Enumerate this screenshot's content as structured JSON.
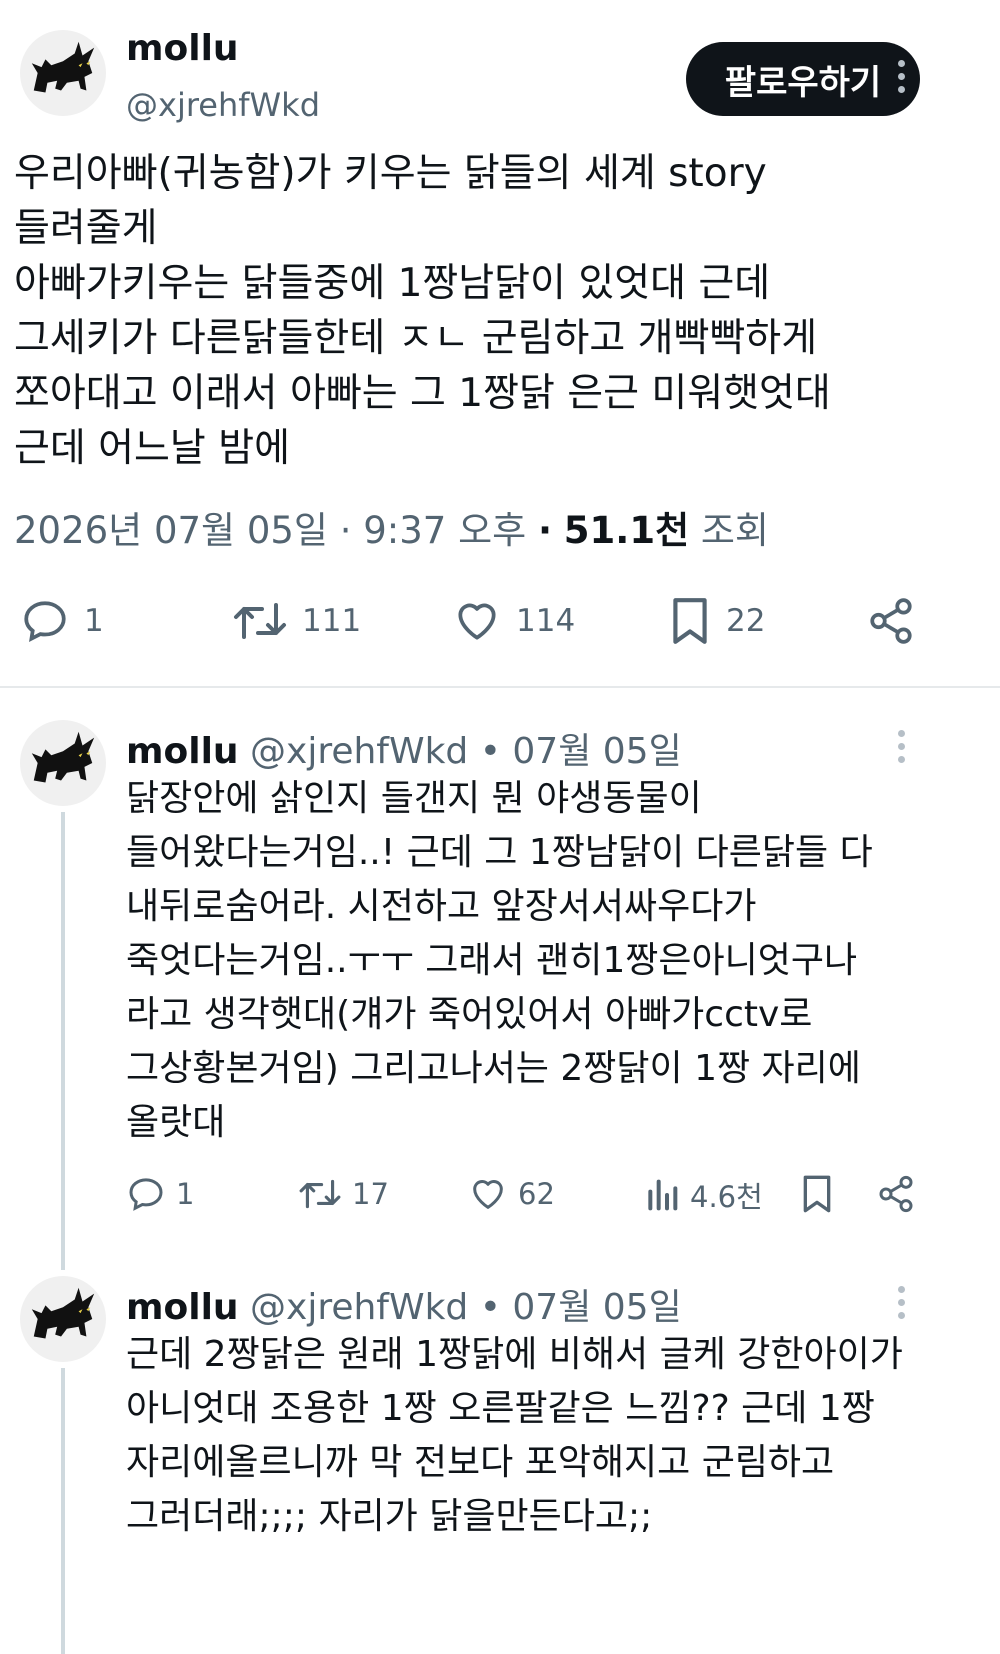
{
  "main_post": {
    "display_name": "mollu",
    "handle": "@xjrehfWkd",
    "follow_label": "팔로우하기",
    "text": "우리아빠(귀농함)가 키우는 닭들의 세계 story\n들려줄게\n아빠가키우는 닭들중에 1짱남닭이 있엇대 근데\n그세키가 다른닭들한테 ㅈㄴ 군림하고 개빡빡하게\n쪼아대고 이래서 아빠는 그 1짱닭 은근 미워햇엇대\n근데 어느날 밤에",
    "date": "2026년 07월 05일 · 9:37 오후",
    "dot": "·",
    "views_count": "51.1천",
    "views_label": "조회",
    "actions": {
      "replies": "1",
      "retweets": "111",
      "likes": "114",
      "bookmarks": "22"
    }
  },
  "replies": [
    {
      "display_name": "mollu",
      "handle_date": "@xjrehfWkd • 07월 05일",
      "text": "닭장안에 삵인지 들갠지 뭔 야생동물이\n들어왔다는거임..! 근데 그 1짱남닭이 다른닭들 다\n내뒤로숨어라. 시전하고 앞장서서싸우다가\n죽엇다는거임..ㅜㅜ 그래서 괜히1짱은아니엇구나\n라고 생각햇대(걔가 죽어있어서 아빠가cctv로\n그상황본거임) 그리고나서는 2짱닭이 1짱 자리에\n올랏대",
      "actions": {
        "replies": "1",
        "retweets": "17",
        "likes": "62",
        "views": "4.6천"
      }
    },
    {
      "display_name": "mollu",
      "handle_date": "@xjrehfWkd • 07월 05일",
      "text": "근데 2짱닭은 원래 1짱닭에 비해서 글케 강한아이가\n아니엇대 조용한 1짱 오른팔같은 느낌?? 근데 1짱\n자리에올르니까 막 전보다 포악해지고 군림하고\n그러더래;;;; 자리가 닭을만든다고;;"
    }
  ]
}
